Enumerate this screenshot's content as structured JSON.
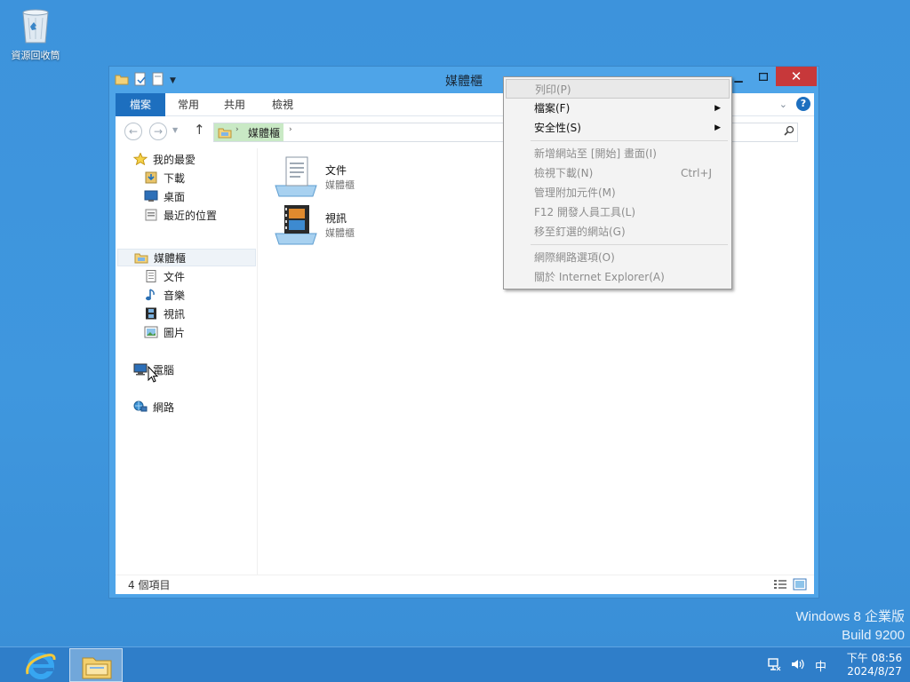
{
  "desktop": {
    "recycle_bin_label": "資源回收筒",
    "watermark_line1": "Windows 8 企業版",
    "watermark_line2": "Build 9200"
  },
  "window": {
    "title": "媒體櫃",
    "tabs": [
      "檔案",
      "常用",
      "共用",
      "檢視"
    ],
    "close_glyph": "✕",
    "address": {
      "crumb": "媒體櫃"
    },
    "nav": {
      "favorites": "我的最愛",
      "downloads": "下載",
      "desktop": "桌面",
      "recent": "最近的位置",
      "libraries": "媒體櫃",
      "documents": "文件",
      "music": "音樂",
      "videos": "視訊",
      "pictures": "圖片",
      "computer": "電腦",
      "network": "網路"
    },
    "items": [
      {
        "name": "文件",
        "type": "媒體櫃"
      },
      {
        "name": "視訊",
        "type": "媒體櫃"
      }
    ],
    "status": "4 個項目"
  },
  "context_menu": {
    "items": [
      {
        "label": "列印(P)",
        "enabled": false
      },
      {
        "label": "檔案(F)",
        "enabled": true
      },
      {
        "label": "安全性(S)",
        "enabled": true
      },
      {
        "label": "新增網站至 [開始] 畫面(I)",
        "enabled": false
      },
      {
        "label": "檢視下載(N)",
        "enabled": false,
        "shortcut": "Ctrl+J"
      },
      {
        "label": "管理附加元件(M)",
        "enabled": false
      },
      {
        "label": "F12 開發人員工具(L)",
        "enabled": false
      },
      {
        "label": "移至釘選的網站(G)",
        "enabled": false
      },
      {
        "label": "網際網路選項(O)",
        "enabled": false
      },
      {
        "label": "關於 Internet Explorer(A)",
        "enabled": false
      }
    ]
  },
  "taskbar": {
    "ime": "中",
    "time": "下午 08:56",
    "date": "2024/8/27"
  },
  "colors": {
    "desktop": "#3f95dd",
    "file_tab": "#1d6fbf",
    "close_button": "#c7383a",
    "taskbar": "#2f7ec9"
  }
}
